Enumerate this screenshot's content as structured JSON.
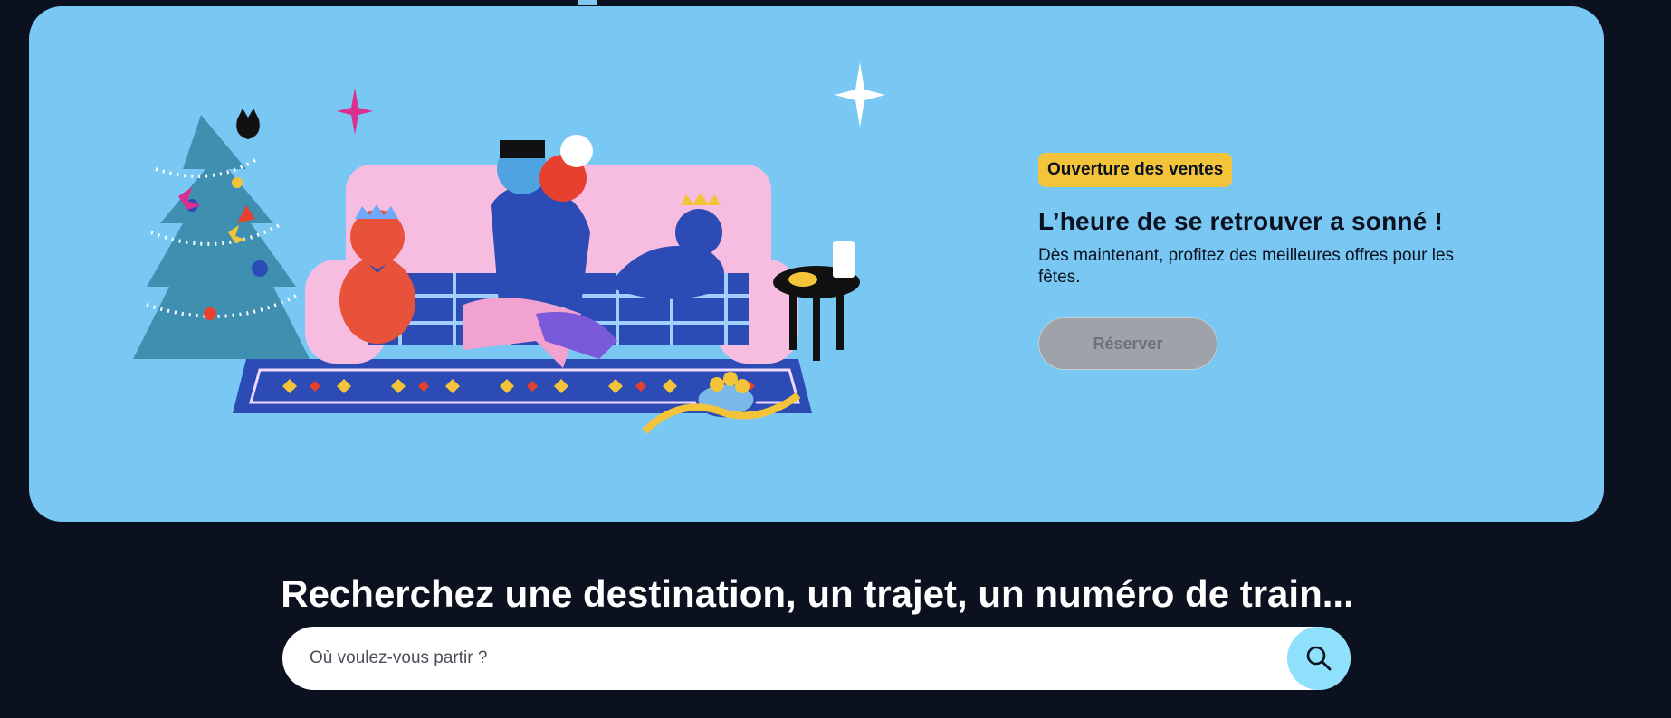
{
  "hero": {
    "badge": "Ouverture des ventes",
    "title": "L’heure de se retrouver a sonné !",
    "text": "Dès maintenant, profitez des meilleures offres pour les fêtes.",
    "button_label": "Réserver",
    "background_color": "#79c7f3",
    "badge_color": "#f3c43a"
  },
  "search": {
    "title": "Recherchez une destination, un trajet, un numéro de train...",
    "placeholder": "Où voulez-vous partir ?",
    "button_icon": "search-icon",
    "button_color": "#8ee0fb"
  },
  "theme": {
    "page_background": "#0b111e"
  }
}
